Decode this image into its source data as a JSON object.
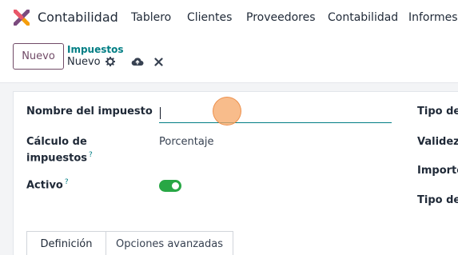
{
  "navbar": {
    "app_name": "Contabilidad",
    "items": [
      "Tablero",
      "Clientes",
      "Proveedores",
      "Contabilidad",
      "Informes"
    ]
  },
  "control_panel": {
    "new_button": "Nuevo",
    "breadcrumb": "Impuestos",
    "record_title": "Nuevo"
  },
  "form": {
    "nombre_label": "Nombre del impuesto",
    "nombre_value": "",
    "calculo_label_1": "Cálculo de",
    "calculo_label_2": "impuestos",
    "calculo_value": "Porcentaje",
    "activo_label": "Activo",
    "activo_on": true,
    "help_mark": "?",
    "right_labels": [
      "Tipo de",
      "Validez",
      "Importe",
      "Tipo de"
    ]
  },
  "tabs": [
    "Definición",
    "Opciones avanzadas"
  ],
  "colors": {
    "brand": "#714b67",
    "accent": "#017e84",
    "toggle_on": "#28a745"
  },
  "icons": {
    "logo": "app-logo-icon",
    "gear": "gear-icon",
    "save": "cloud-upload-icon",
    "discard": "close-icon"
  }
}
